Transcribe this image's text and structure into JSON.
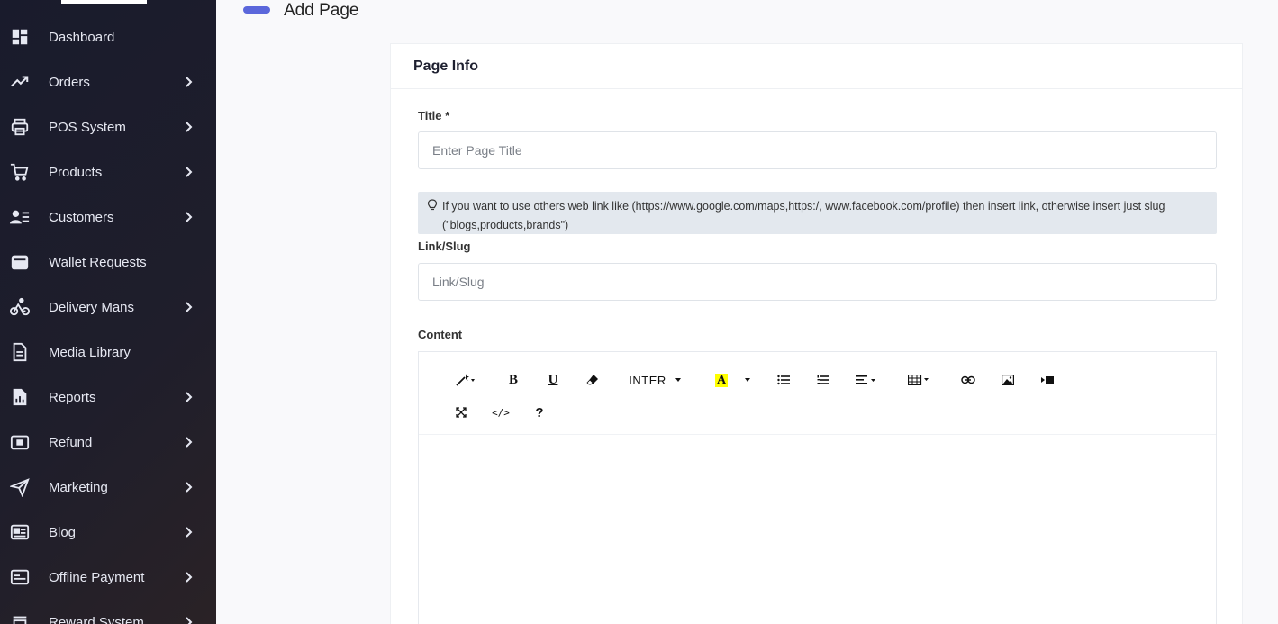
{
  "sidebar": {
    "items": [
      {
        "label": "Dashboard",
        "icon": "dashboard-icon",
        "has_children": false
      },
      {
        "label": "Orders",
        "icon": "trending-icon",
        "has_children": true
      },
      {
        "label": "POS System",
        "icon": "printer-icon",
        "has_children": true
      },
      {
        "label": "Products",
        "icon": "cart-icon",
        "has_children": true
      },
      {
        "label": "Customers",
        "icon": "customers-icon",
        "has_children": true
      },
      {
        "label": "Wallet Requests",
        "icon": "wallet-icon",
        "has_children": false
      },
      {
        "label": "Delivery Mans",
        "icon": "bicycle-icon",
        "has_children": true
      },
      {
        "label": "Media Library",
        "icon": "file-icon",
        "has_children": false
      },
      {
        "label": "Reports",
        "icon": "report-icon",
        "has_children": true
      },
      {
        "label": "Refund",
        "icon": "refund-icon",
        "has_children": true
      },
      {
        "label": "Marketing",
        "icon": "send-icon",
        "has_children": true
      },
      {
        "label": "Blog",
        "icon": "newspaper-icon",
        "has_children": true
      },
      {
        "label": "Offline Payment",
        "icon": "payment-icon",
        "has_children": true
      },
      {
        "label": "Reward System",
        "icon": "reward-icon",
        "has_children": true
      }
    ]
  },
  "header": {
    "title": "Add Page"
  },
  "card": {
    "title": "Page Info",
    "title_field": {
      "label": "Title *",
      "placeholder": "Enter Page Title",
      "value": ""
    },
    "hint": "If you want to use others web link like (https://www.google.com/maps,https:/, www.facebook.com/profile) then insert link, otherwise insert just slug (\"blogs,products,brands\")",
    "slug_field": {
      "label": "Link/Slug",
      "placeholder": "Link/Slug",
      "value": ""
    },
    "content_label": "Content"
  },
  "editor": {
    "font_name": "INTER",
    "code_view_label": "</>",
    "help_label": "?",
    "color_letter": "A",
    "bold_letter": "B",
    "underline_letter": "U"
  },
  "colors": {
    "accent": "#5b67db",
    "highlight": "#ffff00"
  }
}
